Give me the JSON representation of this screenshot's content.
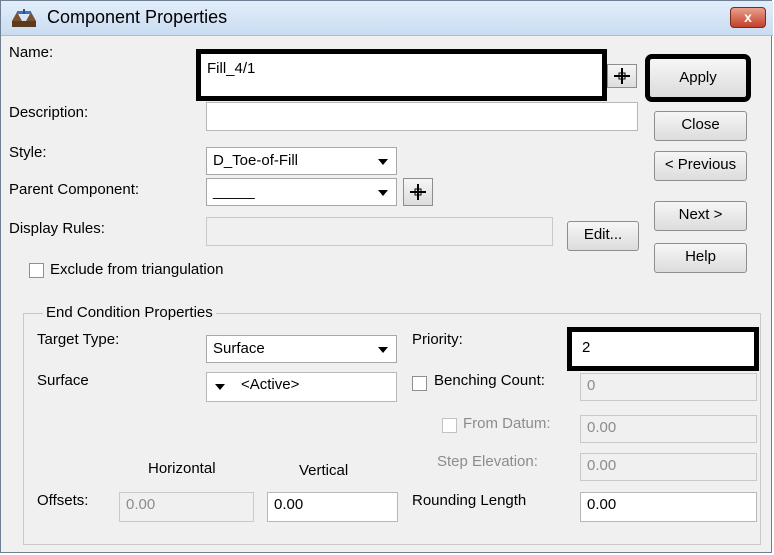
{
  "window": {
    "title": "Component Properties",
    "close_glyph": "x"
  },
  "icons": {
    "app": "component-icon",
    "pick": "crosshair-plus-icon"
  },
  "colors": {
    "title_bar": "#c9dcf1",
    "close_button": "#c2412a",
    "highlight_box": "#000000"
  },
  "form": {
    "name_label": "Name:",
    "name_value": "Fill_4/1",
    "description_label": "Description:",
    "description_value": "",
    "style_label": "Style:",
    "style_value": "D_Toe-of-Fill",
    "parent_label": "Parent Component:",
    "parent_value": "_____",
    "display_rules_label": "Display Rules:",
    "display_rules_value": "",
    "edit_label": "Edit...",
    "exclude_label": "Exclude from triangulation"
  },
  "buttons": {
    "apply": "Apply",
    "close": "Close",
    "previous": "< Previous",
    "next": "Next >",
    "help": "Help"
  },
  "end_condition": {
    "group_label": "End Condition Properties",
    "target_type_label": "Target Type:",
    "target_type_value": "Surface",
    "surface_label": "Surface",
    "surface_value": "<Active>",
    "priority_label": "Priority:",
    "priority_value": "2",
    "benching_count_label": "Benching Count:",
    "benching_count_value": "0",
    "from_datum_label": "From Datum:",
    "from_datum_value": "0.00",
    "step_elevation_label": "Step Elevation:",
    "step_elevation_value": "0.00",
    "horizontal_label": "Horizontal",
    "vertical_label": "Vertical",
    "offsets_label": "Offsets:",
    "horizontal_value": "0.00",
    "vertical_value": "0.00",
    "rounding_length_label": "Rounding Length",
    "rounding_length_value": "0.00"
  }
}
